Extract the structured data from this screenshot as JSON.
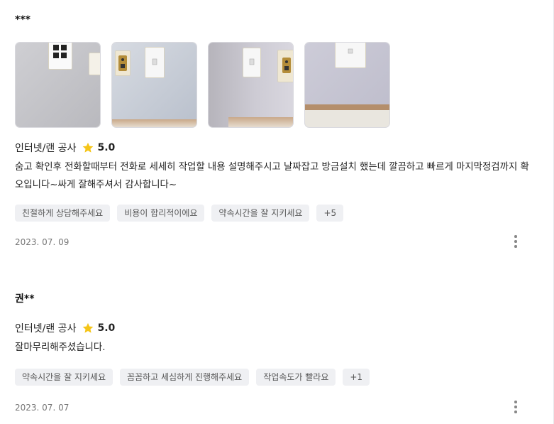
{
  "reviews": [
    {
      "author": "***",
      "photos": [
        {
          "alt": "wall-socket-photo-1"
        },
        {
          "alt": "wall-socket-photo-2"
        },
        {
          "alt": "wall-socket-photo-3"
        },
        {
          "alt": "wall-socket-photo-4"
        }
      ],
      "service": "인터넷/랜 공사",
      "rating": "5.0",
      "text": "숨고 확인후 전화할때부터 전화로 세세히 작업할 내용 설명해주시고 날짜잡고 방금설치 했는데 깔끔하고 빠르게 마지막정검까지 확오입니다~싸게 잘해주셔서 감사합니다~",
      "tags": [
        "친절하게 상담해주세요",
        "비용이 합리적이에요",
        "약속시간을 잘 지키세요",
        "+5"
      ],
      "date": "2023. 07. 09"
    },
    {
      "author": "권**",
      "service": "인터넷/랜 공사",
      "rating": "5.0",
      "text": "잘마무리해주셨습니다.",
      "tags": [
        "약속시간을 잘 지키세요",
        "꼼꼼하고 세심하게 진행해주세요",
        "작업속도가 빨라요",
        "+1"
      ],
      "date": "2023. 07. 07"
    }
  ],
  "colors": {
    "star": "#f5c518",
    "tag_bg": "#eff0f3",
    "text": "#222222",
    "date": "#777777"
  }
}
